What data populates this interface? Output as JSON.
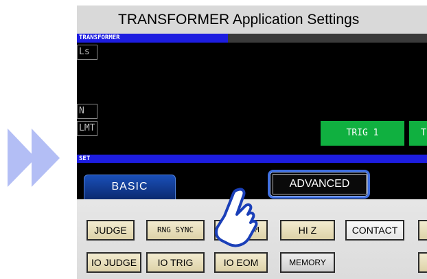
{
  "title": "TRANSFORMER Application Settings",
  "display": {
    "section_label": "TRANSFORMER",
    "params": [
      "Ls",
      "N",
      "LMT"
    ],
    "trig_buttons": [
      "TRIG 1",
      "T"
    ]
  },
  "set": {
    "section_label": "SET",
    "tabs": {
      "basic": "BASIC",
      "advanced": "ADVANCED"
    },
    "buttons_row1": [
      "JUDGE",
      "RNG SYNC",
      "WAVE NUM",
      "HI Z",
      "CONTACT"
    ],
    "buttons_row2": [
      "IO JUDGE",
      "IO TRIG",
      "IO EOM",
      "MEMORY"
    ]
  },
  "colors": {
    "accent_blue": "#1d1de0",
    "trig_green": "#10b040",
    "arrow_fill": "#b3bef5",
    "highlight": "#3f6fe0"
  },
  "icons": [
    "double-arrow-icon",
    "pointing-hand-icon"
  ]
}
